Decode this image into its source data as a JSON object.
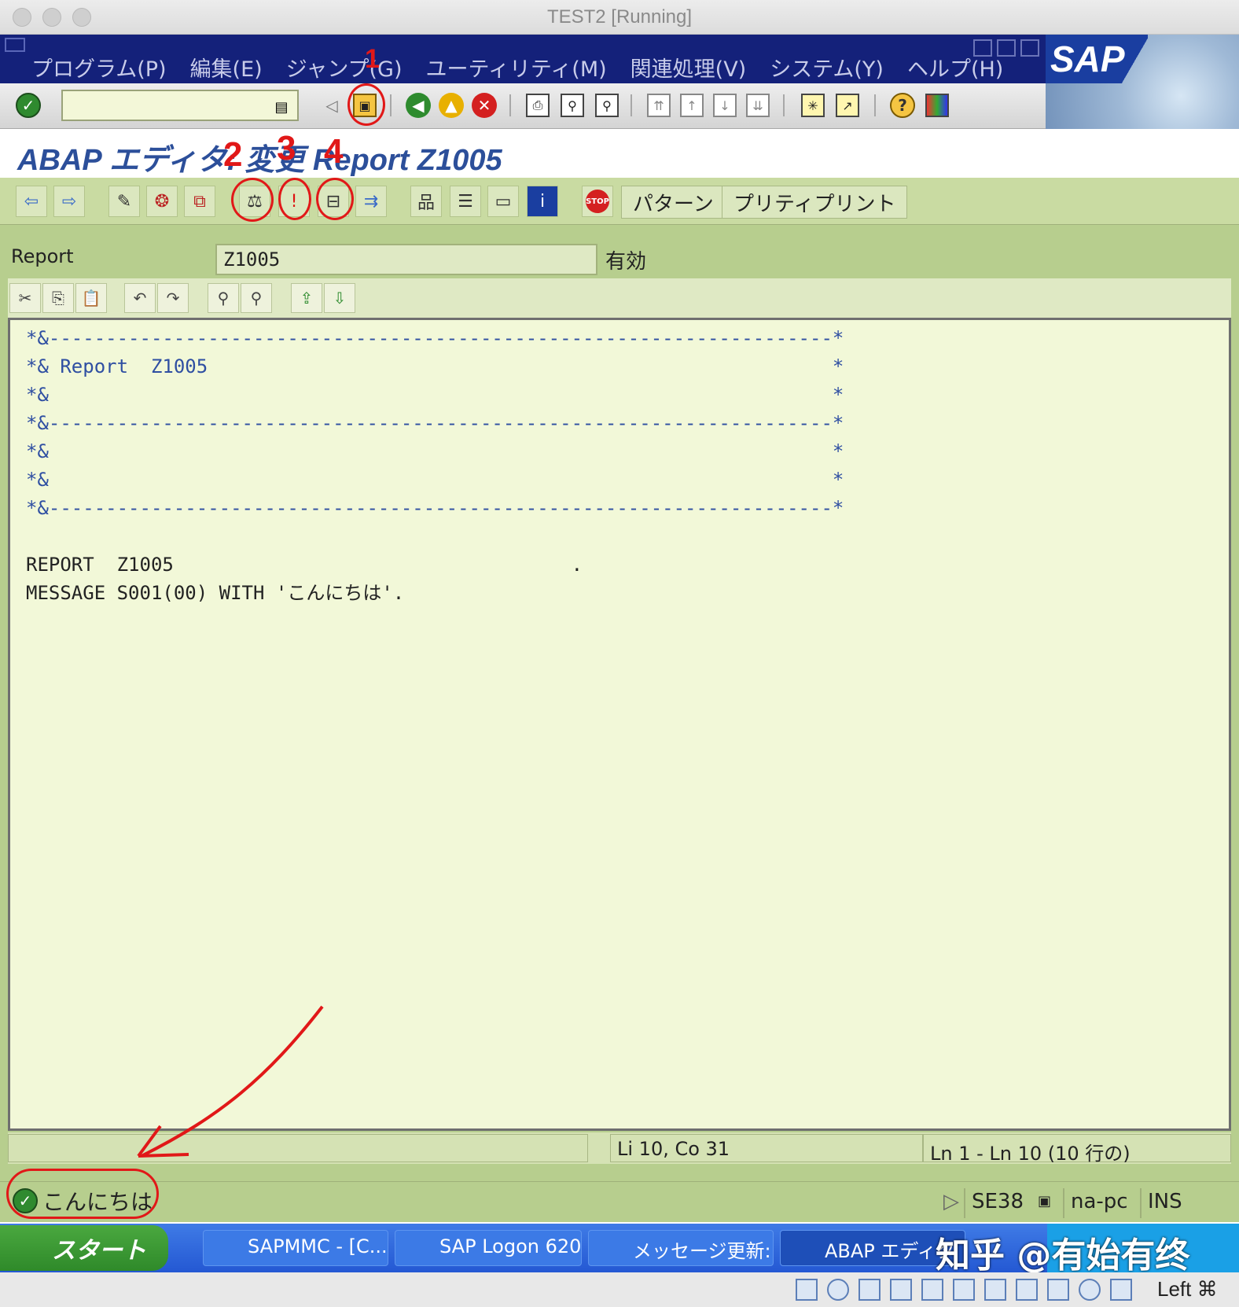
{
  "window": {
    "title": "TEST2 [Running]"
  },
  "menu": {
    "items": [
      "プログラム(P)",
      "編集(E)",
      "ジャンプ(G)",
      "ユーティリティ(M)",
      "関連処理(V)",
      "システム(Y)",
      "ヘルプ(H)"
    ],
    "logo": "SAP"
  },
  "toolbar": {
    "command_value": ""
  },
  "page": {
    "title": "ABAP エディタ: 変更 Report Z1005"
  },
  "app_toolbar": {
    "pattern_label": "パターン",
    "pretty_print_label": "プリティプリント"
  },
  "report": {
    "label": "Report",
    "value": "Z1005",
    "status": "有効"
  },
  "editor": {
    "lines": [
      "*&---------------------------------------------------------------------*",
      "*& Report  Z1005                                                       *",
      "*&                                                                     *",
      "*&---------------------------------------------------------------------*",
      "*&                                                                     *",
      "*&                                                                     *",
      "*&---------------------------------------------------------------------*",
      "",
      "REPORT  Z1005                                   .",
      "MESSAGE S001(00) WITH 'こんにちは'."
    ],
    "cursor_pos": "Li 10, Co 31",
    "line_range": "Ln 1 - Ln 10 (10 行の)"
  },
  "status_bar": {
    "message": "こんにちは",
    "transaction": "SE38",
    "host": "na-pc",
    "mode": "INS"
  },
  "taskbar": {
    "start_label": "スタート",
    "items": [
      "SAPMMC - [C...",
      "SAP Logon 620",
      "メッセージ更新: ...",
      "ABAP エディタ"
    ],
    "watermark": "知乎 @有始有终"
  },
  "vbox": {
    "host_key": "Left ⌘"
  },
  "annotations": {
    "labels": [
      "1",
      "2",
      "3",
      "4"
    ]
  },
  "colors": {
    "menu_bg": "#14217a",
    "green_bg": "#b7ce8e",
    "editor_bg": "#f2f8d8",
    "comment": "#2f4fa2",
    "annotation": "#e11818"
  }
}
